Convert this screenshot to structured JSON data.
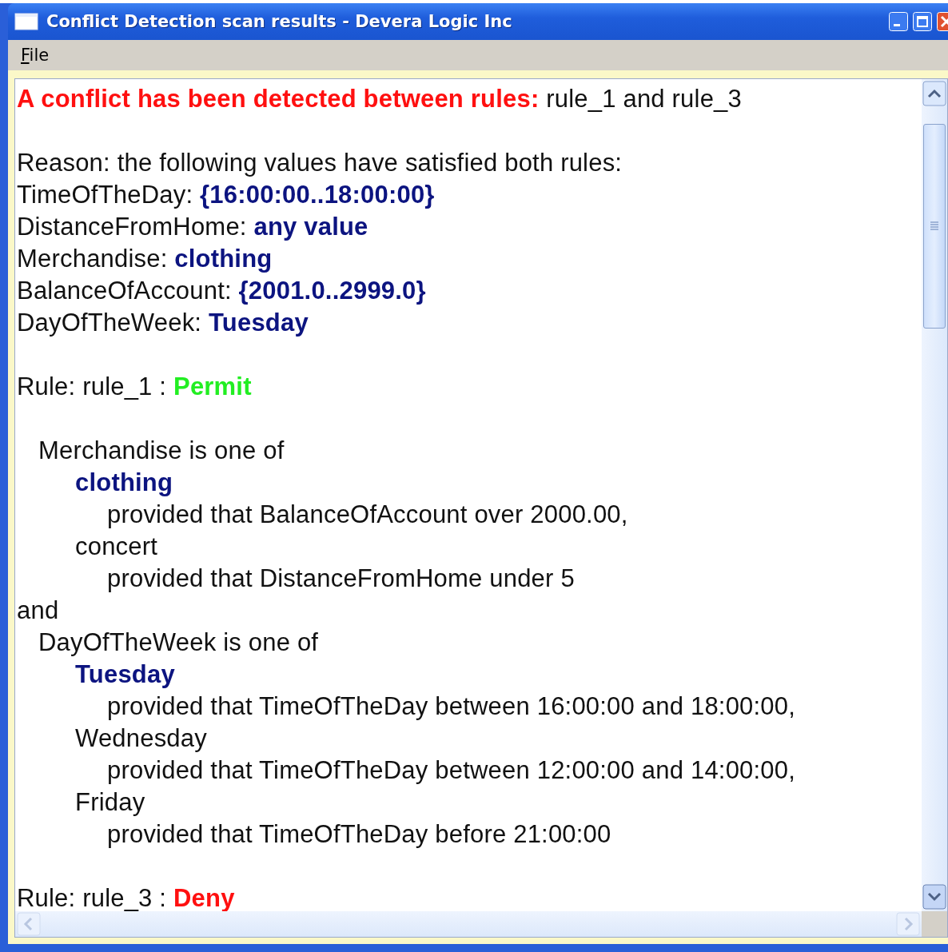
{
  "window": {
    "title": "Conflict Detection scan results - Devera Logic Inc"
  },
  "menu": [
    {
      "label": "File"
    }
  ],
  "document": [
    {
      "kind": "text",
      "segments": [
        {
          "text": "A conflict has been detected between rules:",
          "kind": "alert"
        },
        {
          "text": " rule_1 and rule_3",
          "kind": "plain"
        }
      ]
    },
    {
      "kind": "blank"
    },
    {
      "kind": "text",
      "segments": [
        {
          "text": "Reason: the following values have satisfied both rules:",
          "kind": "plain"
        }
      ]
    },
    {
      "kind": "text",
      "segments": [
        {
          "text": "TimeOfTheDay: ",
          "kind": "plain"
        },
        {
          "text": "{16:00:00..18:00:00}",
          "kind": "value"
        }
      ]
    },
    {
      "kind": "text",
      "segments": [
        {
          "text": "DistanceFromHome: ",
          "kind": "plain"
        },
        {
          "text": "any value",
          "kind": "value"
        }
      ]
    },
    {
      "kind": "text",
      "segments": [
        {
          "text": "Merchandise: ",
          "kind": "plain"
        },
        {
          "text": "clothing",
          "kind": "value"
        }
      ]
    },
    {
      "kind": "text",
      "segments": [
        {
          "text": "BalanceOfAccount: ",
          "kind": "plain"
        },
        {
          "text": "{2001.0..2999.0}",
          "kind": "value"
        }
      ]
    },
    {
      "kind": "text",
      "segments": [
        {
          "text": "DayOfTheWeek: ",
          "kind": "plain"
        },
        {
          "text": "Tuesday",
          "kind": "value"
        }
      ]
    },
    {
      "kind": "blank"
    },
    {
      "kind": "text",
      "segments": [
        {
          "text": "Rule: rule_1 : ",
          "kind": "plain"
        },
        {
          "text": "Permit",
          "kind": "permit"
        }
      ],
      "children": [
        {
          "kind": "blank"
        },
        {
          "kind": "text",
          "segments": [
            {
              "text": "Merchandise is one of",
              "kind": "plain"
            }
          ],
          "children": [
            {
              "kind": "text",
              "segments": [
                {
                  "text": "clothing",
                  "kind": "value"
                }
              ],
              "children": [
                {
                  "kind": "text",
                  "segments": [
                    {
                      "text": "provided that BalanceOfAccount over 2000.00,",
                      "kind": "plain"
                    }
                  ]
                }
              ]
            },
            {
              "kind": "text",
              "segments": [
                {
                  "text": "concert",
                  "kind": "plain"
                }
              ],
              "children": [
                {
                  "kind": "text",
                  "segments": [
                    {
                      "text": "provided that DistanceFromHome under 5",
                      "kind": "plain"
                    }
                  ]
                }
              ]
            }
          ]
        }
      ]
    },
    {
      "kind": "text",
      "segments": [
        {
          "text": "and",
          "kind": "plain"
        }
      ],
      "children": [
        {
          "kind": "text",
          "segments": [
            {
              "text": "DayOfTheWeek is one of",
              "kind": "plain"
            }
          ],
          "children": [
            {
              "kind": "text",
              "segments": [
                {
                  "text": "Tuesday",
                  "kind": "value"
                }
              ],
              "children": [
                {
                  "kind": "text",
                  "segments": [
                    {
                      "text": "provided that TimeOfTheDay between 16:00:00 and 18:00:00,",
                      "kind": "plain"
                    }
                  ]
                }
              ]
            },
            {
              "kind": "text",
              "segments": [
                {
                  "text": "Wednesday",
                  "kind": "plain"
                }
              ],
              "children": [
                {
                  "kind": "text",
                  "segments": [
                    {
                      "text": "provided that TimeOfTheDay between 12:00:00 and 14:00:00,",
                      "kind": "plain"
                    }
                  ]
                }
              ]
            },
            {
              "kind": "text",
              "segments": [
                {
                  "text": "Friday",
                  "kind": "plain"
                }
              ],
              "children": [
                {
                  "kind": "text",
                  "segments": [
                    {
                      "text": "provided that TimeOfTheDay before 21:00:00",
                      "kind": "plain"
                    }
                  ]
                }
              ]
            }
          ]
        }
      ]
    },
    {
      "kind": "blank"
    },
    {
      "kind": "text",
      "segments": [
        {
          "text": "Rule: rule_3 : ",
          "kind": "plain"
        },
        {
          "text": "Deny",
          "kind": "deny"
        }
      ]
    }
  ]
}
